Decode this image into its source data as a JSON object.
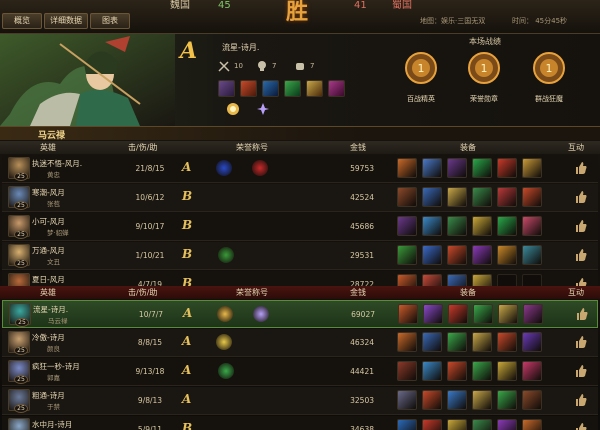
{
  "tabs": [
    {
      "label": "概览"
    },
    {
      "label": "详细数据"
    },
    {
      "label": "图表"
    }
  ],
  "score": {
    "left_team": "魏国",
    "left_score": "45",
    "right_score": "41",
    "right_team": "蜀国",
    "title_art": "胜"
  },
  "map_info": "地图：娱乐·三国无双",
  "time_info": "时间： 45分45秒",
  "hero": {
    "grade": "A",
    "name": "流星-诗月.",
    "kills": "10",
    "deaths": "7",
    "assists": "7"
  },
  "record": {
    "title": "本场战绩",
    "medals": [
      {
        "label": "百战精英"
      },
      {
        "label": "荣誉勋章"
      },
      {
        "label": "群战狂魔"
      }
    ]
  },
  "player_label": "马云禄",
  "headers": {
    "hero": "英雄",
    "kda": "击/伤/助",
    "honor": "荣誉称号",
    "gold": "金钱",
    "equip": "装备",
    "interact": "互动"
  },
  "team1": [
    {
      "name": "执迷不悟-风月.",
      "hero": "黄忠",
      "level": "25",
      "kda": "21/8/15",
      "grade": "A",
      "gold": "59753"
    },
    {
      "name": "寒潮-风月",
      "hero": "张苞",
      "level": "25",
      "kda": "10/6/12",
      "grade": "B",
      "gold": "42524"
    },
    {
      "name": "小可-风月",
      "hero": "梦·貂蝉",
      "level": "25",
      "kda": "9/10/17",
      "grade": "B",
      "gold": "45686"
    },
    {
      "name": "万通-风月",
      "hero": "文丑",
      "level": "25",
      "kda": "1/10/21",
      "grade": "B",
      "gold": "29531"
    },
    {
      "name": "夏日-风月",
      "hero": "魏延",
      "level": "25",
      "kda": "4/7/19",
      "grade": "B",
      "gold": "28722"
    }
  ],
  "team2": [
    {
      "name": "流星-诗月.",
      "hero": "马云禄",
      "level": "25",
      "kda": "10/7/7",
      "grade": "A",
      "gold": "69027"
    },
    {
      "name": "冷傲-诗月",
      "hero": "颜良",
      "level": "25",
      "kda": "8/8/15",
      "grade": "A",
      "gold": "46324"
    },
    {
      "name": "疯狂一秒-诗月",
      "hero": "郭嘉",
      "level": "25",
      "kda": "9/13/18",
      "grade": "A",
      "gold": "44421"
    },
    {
      "name": "粗通-诗月",
      "hero": "于禁",
      "level": "25",
      "kda": "9/8/13",
      "grade": "A",
      "gold": "32503"
    },
    {
      "name": "水中月-诗月",
      "hero": "司马昭",
      "level": "25",
      "kda": "5/9/11",
      "grade": "B",
      "gold": "34638"
    }
  ],
  "colors": {
    "accent": "#f2c14a",
    "team2_header": "#4a1410",
    "highlight_row": "#2e4a26"
  }
}
